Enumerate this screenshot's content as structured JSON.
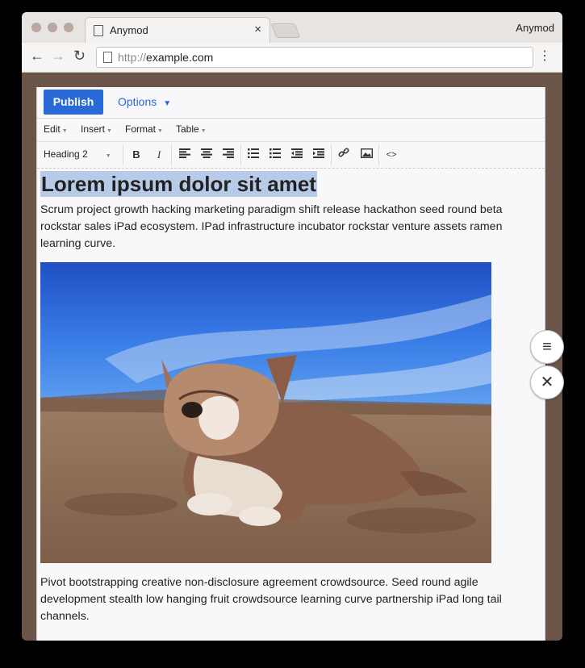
{
  "browser": {
    "tab_title": "Anymod",
    "tab_close": "×",
    "profile_name": "Anymod",
    "url_scheme": "http://",
    "url_host": "example.com",
    "nav": {
      "back": "←",
      "forward": "→",
      "reload": "↻",
      "menu": "⋮"
    }
  },
  "editor": {
    "publish_label": "Publish",
    "options_label": "Options",
    "menus": [
      "Edit",
      "Insert",
      "Format",
      "Table"
    ],
    "block_format": "Heading 2",
    "format_buttons": {
      "bold": "B",
      "italic": "I",
      "code": "<>"
    }
  },
  "document": {
    "heading": "Lorem ipsum dolor sit amet",
    "paragraph1": "Scrum project growth hacking marketing paradigm shift release hackathon seed round beta rockstar sales iPad ecosystem. IPad infrastructure incubator rockstar venture assets ramen learning curve.",
    "paragraph2": "Pivot bootstrapping creative non-disclosure agreement crowdsource. Seed round agile development stealth low hanging fruit crowdsource learning curve partnership iPad long tail channels."
  },
  "side_buttons": {
    "menu_icon": "≡",
    "close_icon": "✕"
  },
  "colors": {
    "publish": "#2a6ad8",
    "options": "#2a6ad8",
    "heading_highlight": "#b7cbe9",
    "frame": "#6b5448"
  }
}
